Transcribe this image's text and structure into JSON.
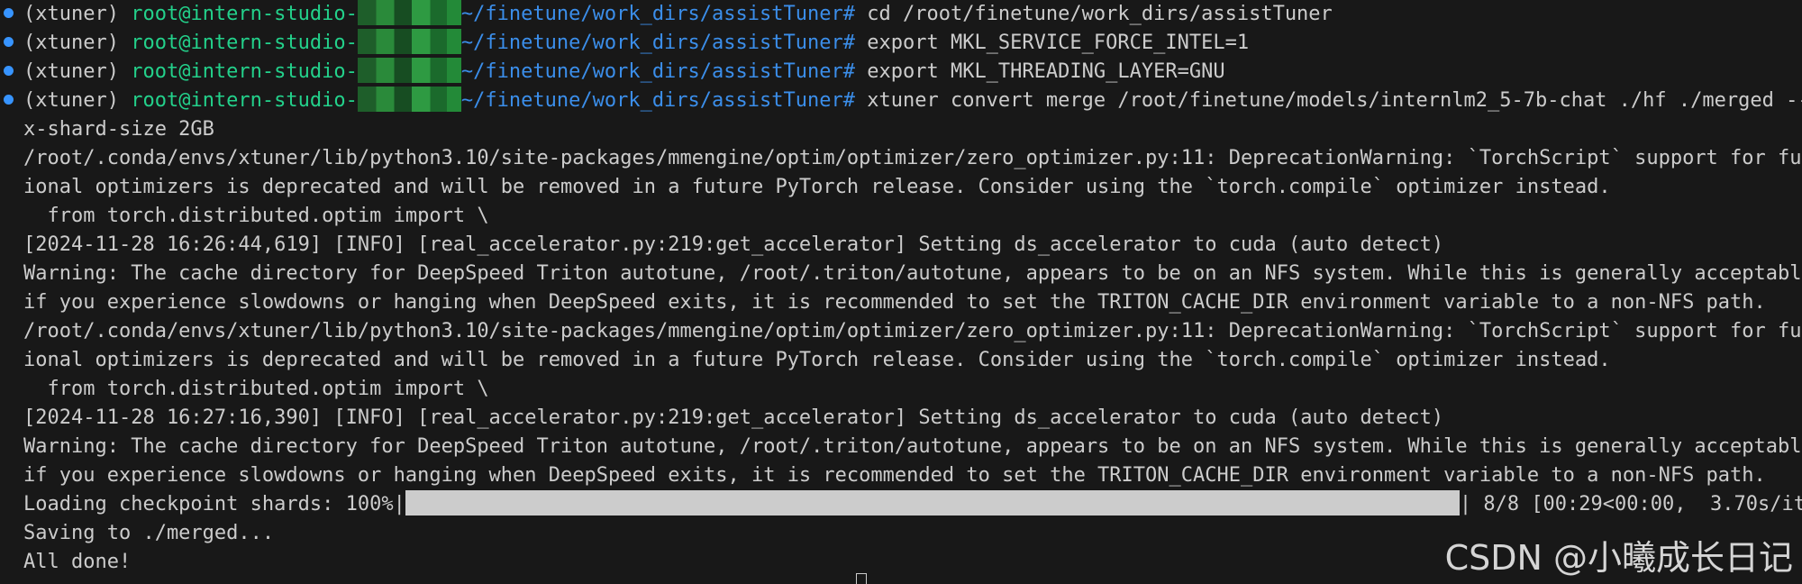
{
  "prompt": {
    "env": "(xtuner)",
    "user_host": "root@intern-studio-",
    "path": "~/finetune/work_dirs/assistTuner#"
  },
  "commands": [
    "cd /root/finetune/work_dirs/assistTuner",
    "export MKL_SERVICE_FORCE_INTEL=1",
    "export MKL_THREADING_LAYER=GNU",
    "xtuner convert merge /root/finetune/models/internlm2_5-7b-chat ./hf ./merged --ma"
  ],
  "output_lines": [
    "x-shard-size 2GB",
    "/root/.conda/envs/xtuner/lib/python3.10/site-packages/mmengine/optim/optimizer/zero_optimizer.py:11: DeprecationWarning: `TorchScript` support for funct",
    "ional optimizers is deprecated and will be removed in a future PyTorch release. Consider using the `torch.compile` optimizer instead.",
    "  from torch.distributed.optim import \\",
    "[2024-11-28 16:26:44,619] [INFO] [real_accelerator.py:219:get_accelerator] Setting ds_accelerator to cuda (auto detect)",
    "Warning: The cache directory for DeepSpeed Triton autotune, /root/.triton/autotune, appears to be on an NFS system. While this is generally acceptable,",
    "if you experience slowdowns or hanging when DeepSpeed exits, it is recommended to set the TRITON_CACHE_DIR environment variable to a non-NFS path.",
    "/root/.conda/envs/xtuner/lib/python3.10/site-packages/mmengine/optim/optimizer/zero_optimizer.py:11: DeprecationWarning: `TorchScript` support for funct",
    "ional optimizers is deprecated and will be removed in a future PyTorch release. Consider using the `torch.compile` optimizer instead.",
    "  from torch.distributed.optim import \\",
    "[2024-11-28 16:27:16,390] [INFO] [real_accelerator.py:219:get_accelerator] Setting ds_accelerator to cuda (auto detect)",
    "Warning: The cache directory for DeepSpeed Triton autotune, /root/.triton/autotune, appears to be on an NFS system. While this is generally acceptable,",
    "if you experience slowdowns or hanging when DeepSpeed exits, it is recommended to set the TRITON_CACHE_DIR environment variable to a non-NFS path."
  ],
  "progress": {
    "label": "Loading checkpoint shards: 100%|",
    "fraction": 1.0,
    "suffix": "| 8/8 [00:29<00:00,  3.70s/it]"
  },
  "final_lines": [
    "Saving to ./merged...",
    "All done!"
  ],
  "watermark": "CSDN @小曦成长日记",
  "colors": {
    "background": "#181818",
    "text": "#cccccc",
    "user_host": "#23d18b",
    "path": "#3b8eea",
    "status_dot": "#3794ff"
  }
}
